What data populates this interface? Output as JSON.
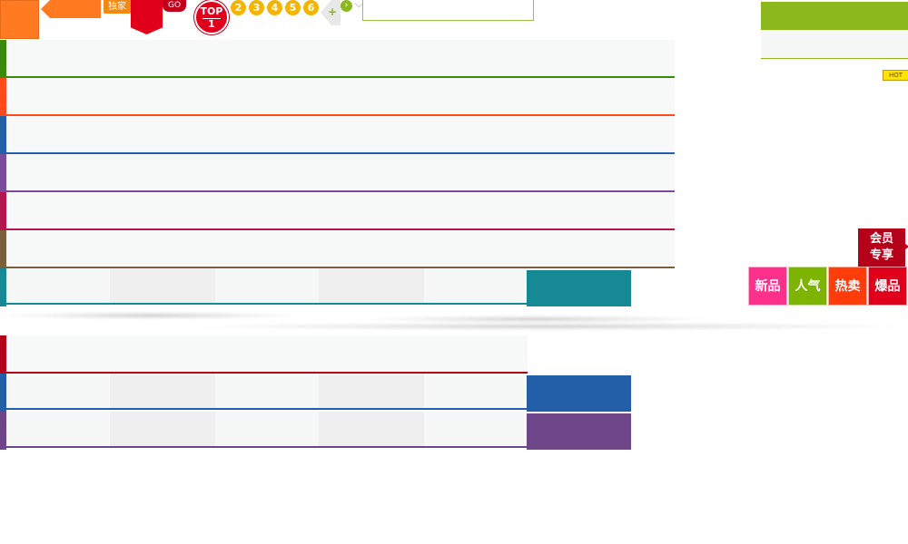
{
  "sprites": {
    "exclusive_label": "独家",
    "go_label": "GO",
    "top_label": "TOP",
    "top_number": "1",
    "page_numbers": [
      "2",
      "3",
      "4",
      "5",
      "6"
    ],
    "plus_glyph": "+",
    "next_glyph": "›"
  },
  "search": {
    "value": "",
    "placeholder": ""
  },
  "right_panel": {
    "hot_label": "HOT"
  },
  "category_rows": {
    "colors": [
      "#3a8a0c",
      "#ff4a1c",
      "#225fa8",
      "#7a4a9b",
      "#b5154f",
      "#7a5f3c"
    ]
  },
  "tab_rows": [
    {
      "color": "#158a95",
      "tab_fill": "#158a95"
    },
    {
      "color": "#225fa8",
      "tab_fill": "#225fa8"
    },
    {
      "color": "#6e4589",
      "tab_fill": "#6e4589"
    }
  ],
  "red_row_color": "#b5001a",
  "member_badge": {
    "line1": "会员",
    "line2": "专享"
  },
  "labels": [
    {
      "text": "新品",
      "color": "#ff2f8c"
    },
    {
      "text": "人气",
      "color": "#7cb400"
    },
    {
      "text": "热卖",
      "color": "#ff3c0a"
    },
    {
      "text": "爆品",
      "color": "#e0001b"
    }
  ]
}
